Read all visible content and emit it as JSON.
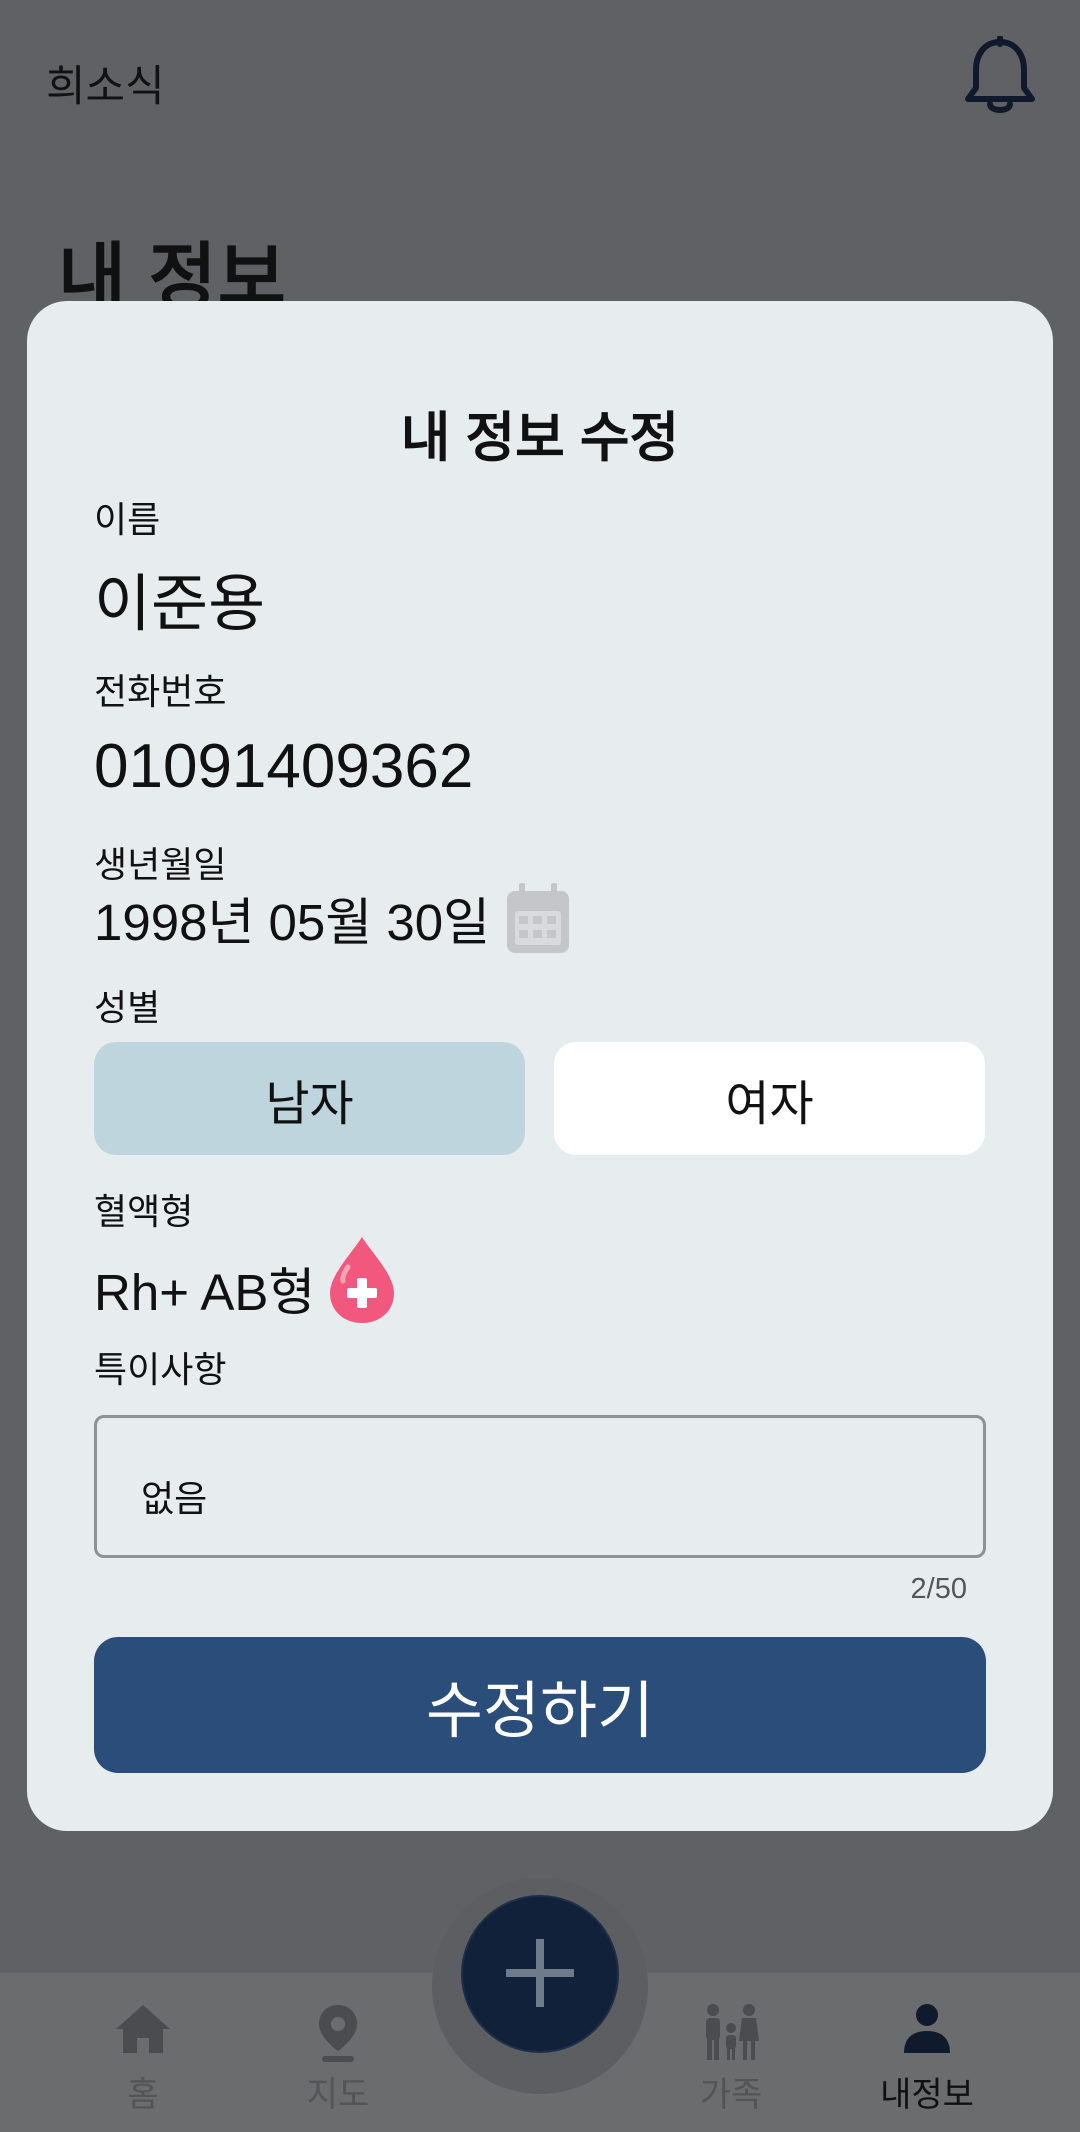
{
  "app": {
    "title": "희소식"
  },
  "page": {
    "title": "내 정보"
  },
  "modal": {
    "title": "내 정보 수정",
    "name_label": "이름",
    "name_value": "이준용",
    "phone_label": "전화번호",
    "phone_value": "01091409362",
    "birth_label": "생년월일",
    "birth_value": "1998년 05월 30일",
    "gender_label": "성별",
    "gender_options": [
      "남자",
      "여자"
    ],
    "gender_selected": "남자",
    "blood_label": "혈액형",
    "blood_value": "Rh+ AB형",
    "note_label": "특이사항",
    "note_value": "없음",
    "note_counter": "2/50",
    "submit_label": "수정하기"
  },
  "nav": {
    "items": [
      {
        "label": "홈",
        "icon": "home-icon"
      },
      {
        "label": "지도",
        "icon": "map-pin-icon"
      },
      {
        "label": "가족",
        "icon": "family-icon"
      },
      {
        "label": "내정보",
        "icon": "person-icon"
      }
    ],
    "active": "내정보",
    "fab_icon": "plus-icon"
  },
  "colors": {
    "overlay_bg": "#5f6164",
    "modal_bg": "#e7ecef",
    "selected_gender": "#bfd5dd",
    "submit_bg": "#2a4d79",
    "fab_bg": "#11213a",
    "blood_drop": "#f2587d"
  }
}
